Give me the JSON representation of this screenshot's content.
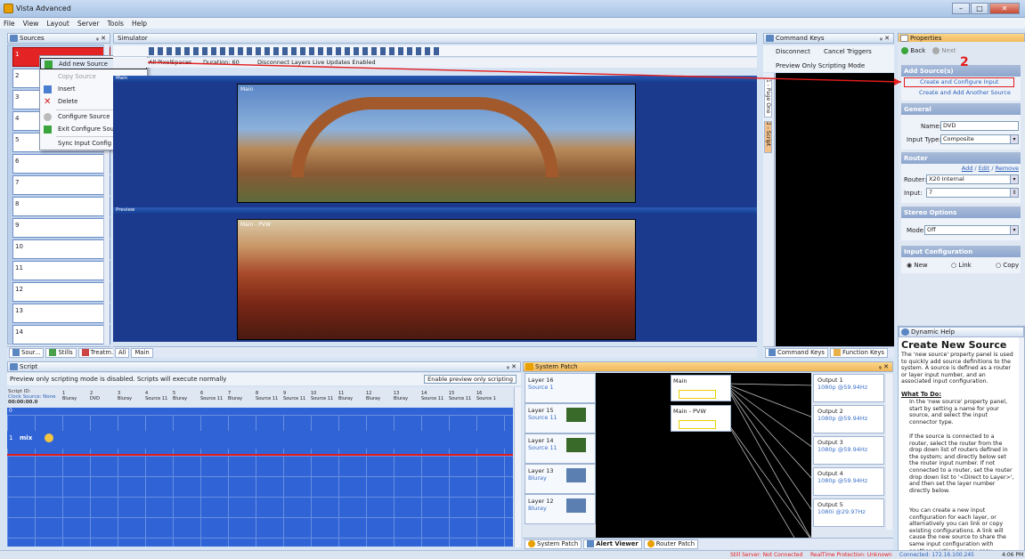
{
  "app": {
    "title": "Vista Advanced"
  },
  "menu": [
    "File",
    "View",
    "Layout",
    "Server",
    "Tools",
    "Help"
  ],
  "sources": {
    "title": "Sources",
    "rows": [
      "1",
      "2",
      "3",
      "4",
      "5",
      "6",
      "7",
      "8",
      "9",
      "10",
      "11",
      "12",
      "13",
      "14"
    ],
    "tabs": [
      "Sour...",
      "Stills",
      "Treatm..."
    ]
  },
  "context_menu": {
    "items": [
      "Add new Source",
      "Copy Source",
      "Insert",
      "Delete",
      "Configure Source",
      "Exit Configure Source",
      "Sync Input Config Names..."
    ]
  },
  "annotations": {
    "step1": "1",
    "step2": "2"
  },
  "simulator": {
    "title": "Simulator",
    "options": {
      "pixelspaces": "All PixelSpaces",
      "duration": "Duration: 60",
      "disconnect": "Disconnect Layers",
      "live": "Live Updates Enabled"
    },
    "main_label": "Main",
    "preview_label": "Preview",
    "main_image_label": "Main",
    "pvw_image_label": "Main - PVW",
    "tabs": [
      "All",
      "Main"
    ]
  },
  "command_keys": {
    "title": "Command Keys",
    "disconnect": "Disconnect",
    "cancel": "Cancel Triggers",
    "preview_mode": "Preview Only Scripting Mode",
    "side_tabs": [
      "1 - Page One",
      "2 - Script"
    ],
    "bottom_tabs": [
      "Command Keys",
      "Function Keys"
    ]
  },
  "properties": {
    "title": "Properties",
    "back": "Back",
    "next": "Next",
    "add_source_header": "Add Source(s)",
    "create_configure": "Create and Configure Input",
    "create_add_another": "Create and Add Another Source",
    "general": "General",
    "name_label": "Name:",
    "name_value": "DVD",
    "input_type_label": "Input Type:",
    "input_type_value": "Composite",
    "router": "Router",
    "router_links": {
      "add": "Add",
      "edit": "Edit",
      "remove": "Remove"
    },
    "router_label": "Router:",
    "router_value": "X20 Internal",
    "input_label": "Input:",
    "input_value": "7",
    "stereo": "Stereo Options",
    "mode_label": "Mode:",
    "mode_value": "Off",
    "input_config": "Input Configuration",
    "radios": [
      "New",
      "Link",
      "Copy"
    ]
  },
  "dynamic_help": {
    "title": "Dynamic Help",
    "heading": "Create New Source",
    "intro": "The 'new source' property panel is used to quickly add source definitions to the system.  A source is defined as a router or layer input number, and an associated input configuration.",
    "todo": "What To Do:",
    "bullets": [
      "In the 'new source' property panel, start by setting a name for your source, and select the input connector type.",
      "If the source is connected to a router, select the router from the drop down list of routers defined in the system; and directly below set the router input number.  If not connected to a router, set the router drop down list to '<Direct to Layer>', and then set the layer number directly below.",
      "You can create a new input configuration for each layer, or alternatively you can link or copy existing configurations.  A link will cause the new source to share the same input configuration with another existing source; copy"
    ]
  },
  "script": {
    "title": "Script",
    "notice": "Preview only scripting mode is disabled.  Scripts will execute normally",
    "enable_btn": "Enable preview only scripting",
    "script_id": "Script ID:",
    "clock_source": "Clock Source: None",
    "timecode": "00:00:00.0",
    "columns": [
      {
        "n": "1",
        "s": "Bluray"
      },
      {
        "n": "2",
        "s": "DVD"
      },
      {
        "n": "3",
        "s": "Bluray"
      },
      {
        "n": "4",
        "s": "Source 11"
      },
      {
        "n": "5",
        "s": "Bluray"
      },
      {
        "n": "6",
        "s": "Source 11"
      },
      {
        "n": "7",
        "s": "Bluray"
      },
      {
        "n": "8",
        "s": "Source 11"
      },
      {
        "n": "9",
        "s": "Source 11"
      },
      {
        "n": "10",
        "s": "Source 11"
      },
      {
        "n": "11",
        "s": "Bluray"
      },
      {
        "n": "12",
        "s": "Bluray"
      },
      {
        "n": "13",
        "s": "Bluray"
      },
      {
        "n": "14",
        "s": "Source 11"
      },
      {
        "n": "15",
        "s": "Source 11"
      },
      {
        "n": "16",
        "s": "Source 1"
      }
    ],
    "row0": "0",
    "row1": "1",
    "mix": "mix"
  },
  "system_patch": {
    "title": "System Patch",
    "layers": [
      {
        "name": "Layer 16",
        "src": "Source 1"
      },
      {
        "name": "Layer 15",
        "src": "Source 11"
      },
      {
        "name": "Layer 14",
        "src": "Source 11"
      },
      {
        "name": "Layer 13",
        "src": "Bluray"
      },
      {
        "name": "Layer 12",
        "src": "Bluray"
      }
    ],
    "destinations": [
      "Main",
      "Main - PVW"
    ],
    "outputs": [
      {
        "name": "Output 1",
        "fmt": "1080p @59.94Hz"
      },
      {
        "name": "Output 2",
        "fmt": "1080p @59.94Hz"
      },
      {
        "name": "Output 3",
        "fmt": "1080p @59.94Hz"
      },
      {
        "name": "Output 4",
        "fmt": "1080p @59.94Hz"
      },
      {
        "name": "Output 5",
        "fmt": "1080i @29.97Hz"
      }
    ],
    "tabs": [
      "System Patch",
      "Alert Viewer",
      "Router Patch"
    ]
  },
  "status": {
    "still": "Still Server: Not Connected",
    "realtime": "RealTime Protection: Unknown",
    "connected": "Connected: 172.16.100.245",
    "time": "4:06 PM"
  },
  "colors": {
    "accent": "#2f63d6",
    "red": "#e41c1c",
    "panel": "#dfe7f3"
  }
}
